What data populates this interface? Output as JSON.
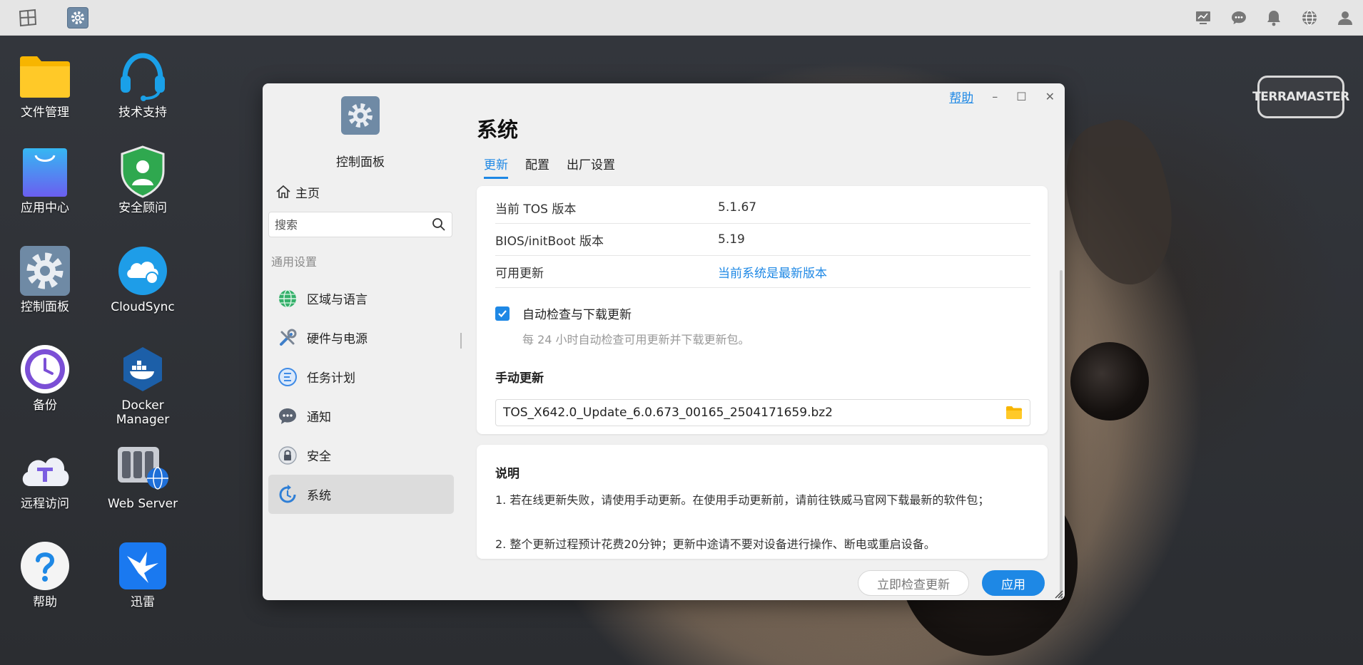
{
  "taskbar": {
    "right_icons": [
      "monitor-chart-icon",
      "chat-icon",
      "bell-icon",
      "globe-icon",
      "user-icon"
    ]
  },
  "desktop": {
    "icons": [
      {
        "label": "文件管理",
        "icon": "folder-icon"
      },
      {
        "label": "技术支持",
        "icon": "headset-icon"
      },
      {
        "label": "应用中心",
        "icon": "shopping-bag-icon"
      },
      {
        "label": "安全顾问",
        "icon": "security-shield-icon"
      },
      {
        "label": "控制面板",
        "icon": "gear-icon"
      },
      {
        "label": "CloudSync",
        "icon": "cloud-sync-icon"
      },
      {
        "label": "备份",
        "icon": "backup-clock-icon"
      },
      {
        "label": "Docker Manager",
        "icon": "docker-icon"
      },
      {
        "label": "远程访问",
        "icon": "remote-access-icon"
      },
      {
        "label": "Web Server",
        "icon": "web-server-icon"
      },
      {
        "label": "帮助",
        "icon": "help-icon"
      },
      {
        "label": "迅雷",
        "icon": "xunlei-icon"
      }
    ],
    "brand": "TERRAMASTER"
  },
  "window": {
    "sidebar": {
      "title": "控制面板",
      "home": "主页",
      "search_placeholder": "搜索",
      "section": "通用设置",
      "items": [
        {
          "label": "区域与语言",
          "icon": "globe-icon"
        },
        {
          "label": "硬件与电源",
          "icon": "tools-icon"
        },
        {
          "label": "任务计划",
          "icon": "task-list-icon"
        },
        {
          "label": "通知",
          "icon": "chat-bubble-icon"
        },
        {
          "label": "安全",
          "icon": "lock-icon"
        },
        {
          "label": "系统",
          "icon": "system-update-icon"
        }
      ],
      "active_item": "系统"
    },
    "controls": {
      "help": "帮助",
      "minimize": "–",
      "maximize": "☐",
      "close": "✕"
    },
    "content": {
      "title": "系统",
      "tabs": [
        "更新",
        "配置",
        "出厂设置"
      ],
      "active_tab": "更新",
      "info": [
        {
          "label": "当前 TOS 版本",
          "value": "5.1.67"
        },
        {
          "label": "BIOS/initBoot 版本",
          "value": "5.19"
        },
        {
          "label": "可用更新",
          "value": "当前系统是最新版本"
        }
      ],
      "auto_update": {
        "label": "自动检查与下载更新",
        "checked": true,
        "description": "每 24 小时自动检查可用更新并下载更新包。"
      },
      "manual": {
        "title": "手动更新",
        "file": "TOS_X642.0_Update_6.0.673_00165_2504171659.bz2"
      },
      "notes": {
        "title": "说明",
        "lines": [
          "1. 若在线更新失败，请使用手动更新。在使用手动更新前，请前往铁威马官网下载最新的软件包；",
          "2. 整个更新过程预计花费20分钟；更新中途请不要对设备进行操作、断电或重启设备。"
        ]
      }
    },
    "footer": {
      "check_now": "立即检查更新",
      "apply": "应用"
    }
  },
  "colors": {
    "accent": "#1e88e5",
    "taskbar": "#e5e5e5",
    "window_bg": "#f0f0f0"
  }
}
